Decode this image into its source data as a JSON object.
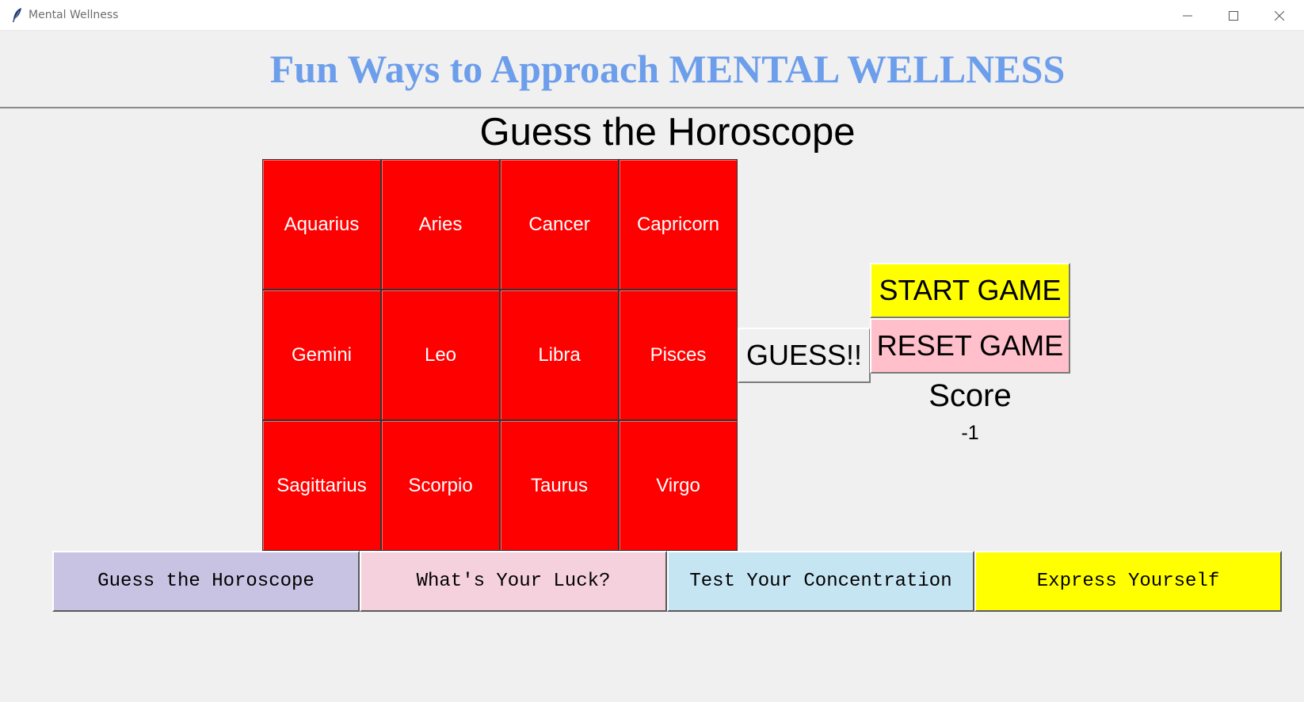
{
  "window": {
    "title": "Mental Wellness",
    "controls": [
      "minimize-icon",
      "maximize-icon",
      "close-icon"
    ]
  },
  "header": {
    "heading": "Fun Ways to Approach MENTAL WELLNESS",
    "heading_color": "#6d9eeb"
  },
  "game": {
    "title": "Guess the Horoscope",
    "tile_color": "#ff0000",
    "signs": [
      "Aquarius",
      "Aries",
      "Cancer",
      "Capricorn",
      "Gemini",
      "Leo",
      "Libra",
      "Pisces",
      "Sagittarius",
      "Scorpio",
      "Taurus",
      "Virgo"
    ],
    "guess_label": "GUESS!!",
    "start_label": "START GAME",
    "start_color": "#ffff00",
    "reset_label": "RESET GAME",
    "reset_color": "#ffc0cb",
    "score_label": "Score",
    "score_value": "-1"
  },
  "nav": {
    "items": [
      {
        "label": "Guess the Horoscope",
        "color": "#c8c2e3"
      },
      {
        "label": "What's Your Luck?",
        "color": "#f5d1dd"
      },
      {
        "label": "Test Your Concentration",
        "color": "#c6e5f3"
      },
      {
        "label": "Express Yourself",
        "color": "#ffff00"
      }
    ]
  }
}
